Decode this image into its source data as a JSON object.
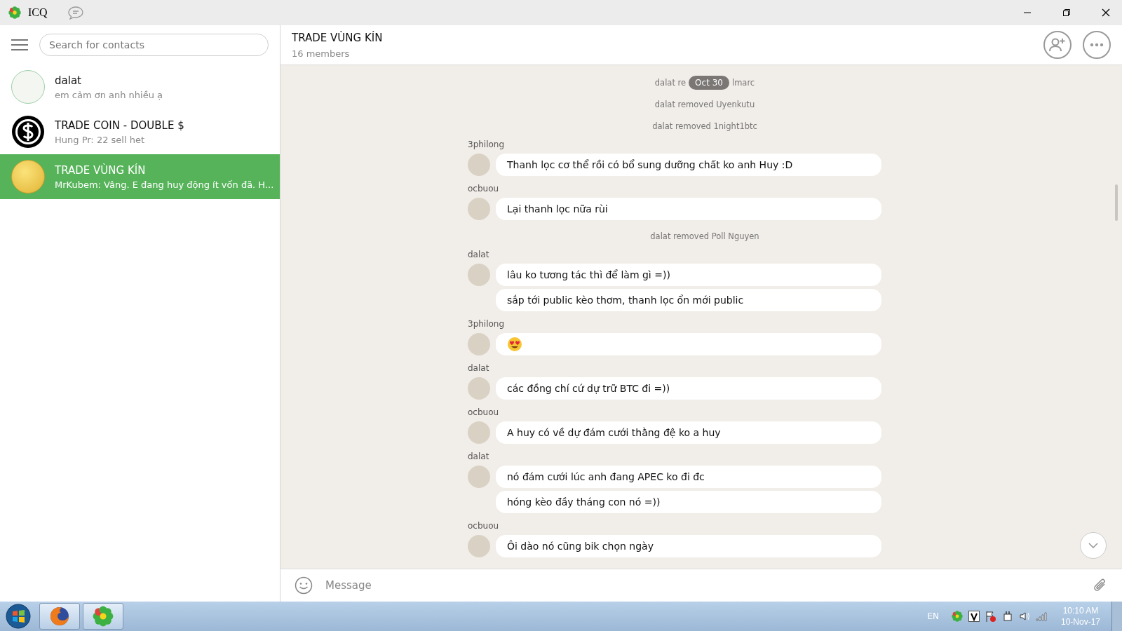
{
  "window": {
    "title": "ICQ"
  },
  "sidebar": {
    "search": {
      "placeholder": "Search for contacts"
    },
    "contacts": [
      {
        "name": "dalat",
        "preview": "em cảm ơn anh nhiều ạ",
        "selected": false
      },
      {
        "name": "TRADE COIN - DOUBLE $",
        "preview": "Hung Pr: 22 sell het",
        "selected": false
      },
      {
        "name": "TRADE VÙNG KÍN",
        "preview": "MrKubem: Vâng. E đang huy động ít vốn đã. H...",
        "selected": true
      }
    ]
  },
  "chat": {
    "title": "TRADE VÙNG KÍN",
    "subtitle": "16 members",
    "feed": [
      {
        "kind": "system_cut",
        "left": "dalat re",
        "date": "Oct 30",
        "right": "lmarc"
      },
      {
        "kind": "system",
        "text": "dalat removed Uyenkutu"
      },
      {
        "kind": "system",
        "text": "dalat removed 1night1btc"
      },
      {
        "kind": "group",
        "sender": "3philong",
        "bubbles": [
          {
            "kind": "text",
            "text": "Thanh lọc cơ thể rồi có bổ sung dưỡng chất ko anh Huy :D"
          }
        ]
      },
      {
        "kind": "group",
        "sender": "ocbuou",
        "bubbles": [
          {
            "kind": "text",
            "text": "Lại thanh lọc nữa rùi"
          }
        ]
      },
      {
        "kind": "system",
        "text": "dalat removed Poll Nguyen"
      },
      {
        "kind": "group",
        "sender": "dalat",
        "bubbles": [
          {
            "kind": "text",
            "text": "lâu ko tương tác thì để làm gì =))"
          },
          {
            "kind": "text",
            "text": "sắp tới public kèo thơm, thanh lọc ổn mới public"
          }
        ]
      },
      {
        "kind": "group",
        "sender": "3philong",
        "bubbles": [
          {
            "kind": "emoji"
          }
        ]
      },
      {
        "kind": "group",
        "sender": "dalat",
        "bubbles": [
          {
            "kind": "text",
            "text": "các đồng chí cứ dự trữ BTC đi =))"
          }
        ]
      },
      {
        "kind": "group",
        "sender": "ocbuou",
        "bubbles": [
          {
            "kind": "text",
            "text": "A huy có về dự đám cưới thằng đệ ko a huy"
          }
        ]
      },
      {
        "kind": "group",
        "sender": "dalat",
        "bubbles": [
          {
            "kind": "text",
            "text": "nó đám cưới lúc anh đang APEC ko đi đc"
          },
          {
            "kind": "text",
            "text": "hóng kèo đầy tháng con nó =))"
          }
        ]
      },
      {
        "kind": "group",
        "sender": "ocbuou",
        "bubbles": [
          {
            "kind": "text",
            "text": "Ôi dào nó cũng bik chọn ngày"
          }
        ]
      }
    ],
    "composer": {
      "placeholder": "Message"
    }
  },
  "taskbar": {
    "language": "EN",
    "time": "10:10 AM",
    "date": "10-Nov-17"
  }
}
